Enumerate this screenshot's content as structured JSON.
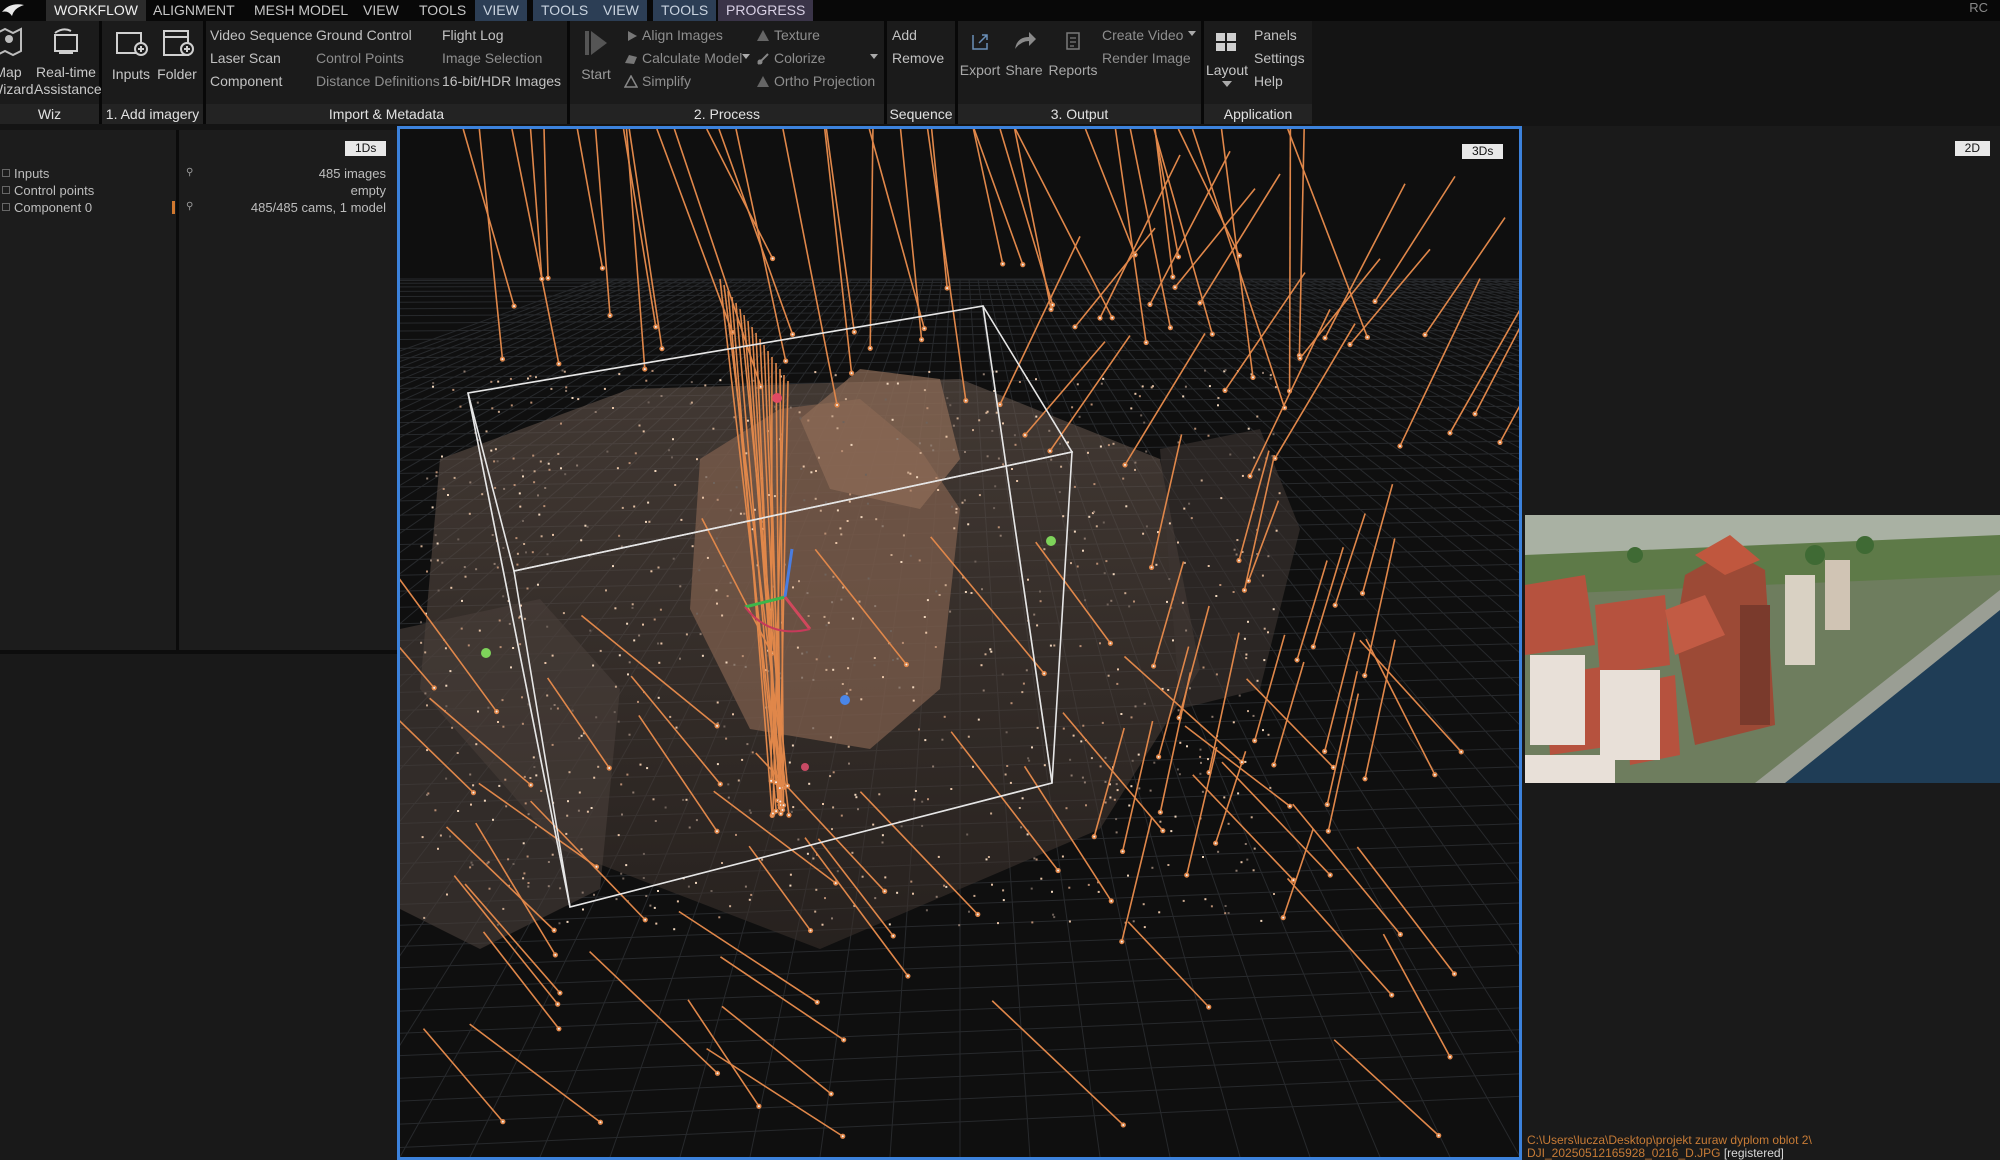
{
  "menu": {
    "tabs": [
      "WORKFLOW",
      "ALIGNMENT",
      "MESH MODEL",
      "VIEW",
      "TOOLS"
    ],
    "context_tabs": [
      "VIEW",
      "TOOLS",
      "VIEW",
      "TOOLS"
    ],
    "progress_tab": "PROGRESS",
    "right_label": "RC"
  },
  "ribbon": {
    "wiz": {
      "map_label": "Map",
      "wizard_label": "Wizard",
      "realtime_line1": "Real-time",
      "realtime_line2": "Assistance",
      "footer": "Wiz"
    },
    "add_imagery": {
      "inputs": "Inputs",
      "folder": "Folder",
      "footer": "1. Add imagery"
    },
    "import": {
      "col1": [
        "Video Sequence",
        "Laser Scan",
        "Component"
      ],
      "col2": [
        "Ground Control",
        "Control Points",
        "Distance Definitions"
      ],
      "col3": [
        "Flight Log",
        "Image Selection",
        "16-bit/HDR Images"
      ],
      "footer": "Import & Metadata"
    },
    "process": {
      "start": "Start",
      "col1": [
        "Align Images",
        "Calculate Model",
        "Simplify"
      ],
      "col2": [
        "Texture",
        "Colorize",
        "Ortho Projection"
      ],
      "footer": "2. Process"
    },
    "sequence": {
      "add": "Add",
      "remove": "Remove",
      "footer": "Sequence"
    },
    "output": {
      "export": "Export",
      "share": "Share",
      "reports": "Reports",
      "create_video": "Create Video",
      "render_image": "Render Image",
      "footer": "3. Output"
    },
    "application": {
      "layout": "Layout",
      "panels": "Panels",
      "settings": "Settings",
      "help": "Help",
      "footer": "Application"
    }
  },
  "panel_1ds": {
    "tag": "1Ds",
    "rows": [
      {
        "name": "Inputs",
        "value": "485 images"
      },
      {
        "name": "Control points",
        "value": "empty"
      },
      {
        "name": "Component 0",
        "value": "485/485 cams, 1 model"
      }
    ]
  },
  "view3d": {
    "tag": "3Ds"
  },
  "panel_2d": {
    "tag": "2D",
    "status_path": "C:\\Users\\lucza\\Desktop\\projekt zuraw dyplom oblot 2\\",
    "status_file": "DJI_20250512165928_0216_D.JPG",
    "status_flag": "[registered]"
  },
  "colors": {
    "accent": "#3c82dc",
    "camera_ray": "#e0874a",
    "status_text": "#c77b36"
  }
}
